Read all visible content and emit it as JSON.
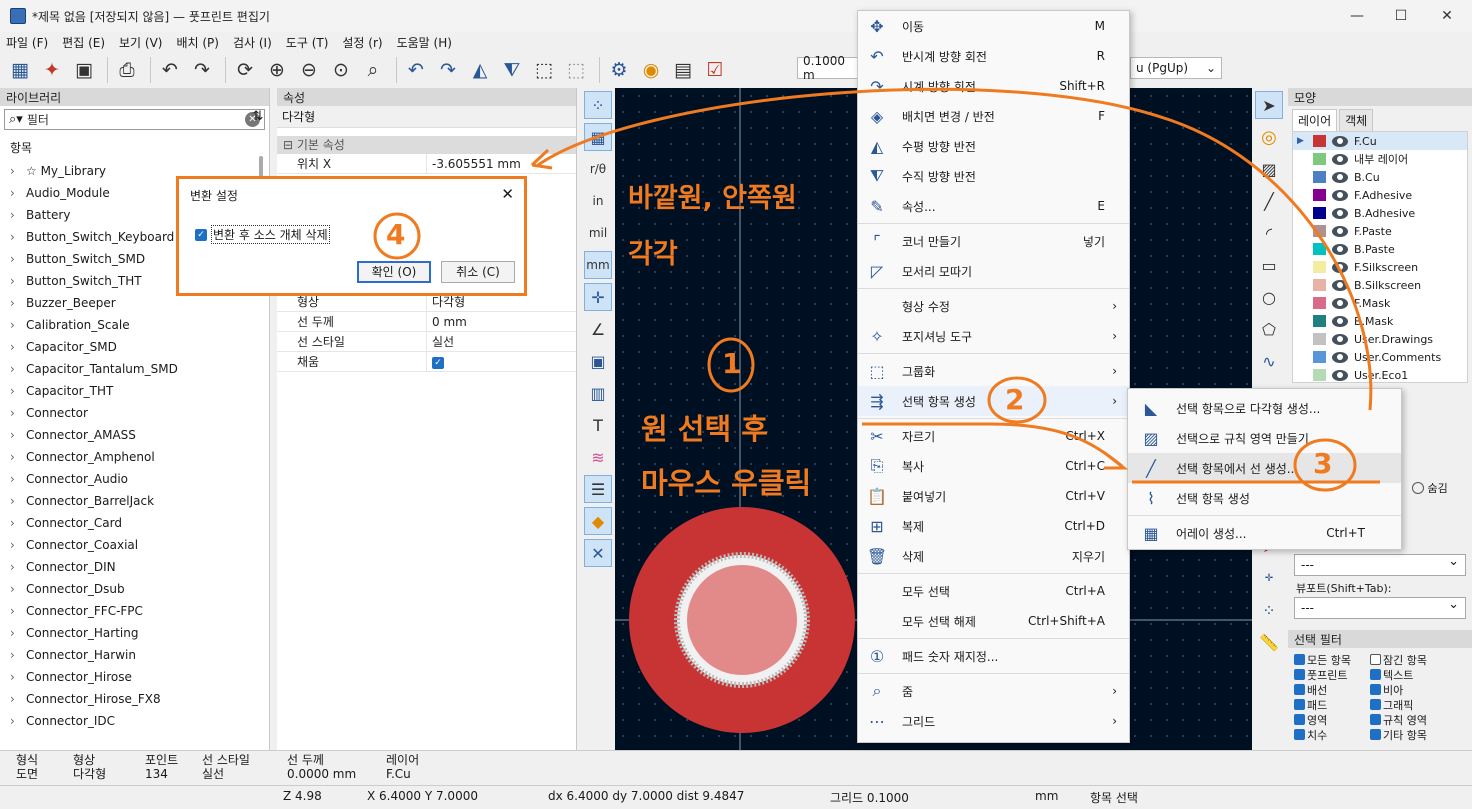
{
  "window": {
    "title": "*제목 없음 [저장되지 않음] — 풋프린트 편집기",
    "minimize": "—",
    "maximize": "☐",
    "close": "✕"
  },
  "menu": [
    "파일 (F)",
    "편집 (E)",
    "보기 (V)",
    "배치 (P)",
    "검사 (I)",
    "도구 (T)",
    "설정 (r)",
    "도움말 (H)"
  ],
  "toolbar": {
    "grid_combo": "0.1000 m",
    "layer_combo": "u (PgUp)"
  },
  "library": {
    "header": "라이브러리",
    "search_placeholder": "필터",
    "column": "항목",
    "items": [
      "☆ My_Library",
      "Audio_Module",
      "Battery",
      "Button_Switch_Keyboard",
      "Button_Switch_SMD",
      "Button_Switch_THT",
      "Buzzer_Beeper",
      "Calibration_Scale",
      "Capacitor_SMD",
      "Capacitor_Tantalum_SMD",
      "Capacitor_THT",
      "Connector",
      "Connector_AMASS",
      "Connector_Amphenol",
      "Connector_Audio",
      "Connector_BarrelJack",
      "Connector_Card",
      "Connector_Coaxial",
      "Connector_DIN",
      "Connector_Dsub",
      "Connector_FFC-FPC",
      "Connector_Harting",
      "Connector_Harwin",
      "Connector_Hirose",
      "Connector_Hirose_FX8",
      "Connector_IDC"
    ]
  },
  "properties": {
    "header": "속성",
    "type": "다각형",
    "section_basic": "기본 속성",
    "pos_x_label": "위치 X",
    "pos_x_value": "-3.605551 mm",
    "rows": [
      {
        "k": "형상",
        "v": "다각형"
      },
      {
        "k": "선 두께",
        "v": "0 mm"
      },
      {
        "k": "선 스타일",
        "v": "실선"
      },
      {
        "k": "채움",
        "v": ""
      }
    ]
  },
  "ltools": [
    "r/θ",
    "in",
    "mil",
    "mm"
  ],
  "dialog": {
    "title": "변환 설정",
    "checkbox": "변환 후 소스 개체 삭제",
    "ok": "확인 (O)",
    "cancel": "취소 (C)",
    "close": "✕"
  },
  "context_menu": [
    {
      "icon": "✥",
      "label": "이동",
      "shortcut": "M"
    },
    {
      "icon": "↶",
      "label": "반시계 방향 회전",
      "shortcut": "R"
    },
    {
      "icon": "↷",
      "label": "시계 방향 회전",
      "shortcut": "Shift+R"
    },
    {
      "icon": "◈",
      "label": "배치면 변경 / 반전",
      "shortcut": "F"
    },
    {
      "icon": "◭",
      "label": "수평 방향 반전",
      "shortcut": ""
    },
    {
      "icon": "⧨",
      "label": "수직 방향 반전",
      "shortcut": ""
    },
    {
      "icon": "✎",
      "label": "속성...",
      "shortcut": "E"
    },
    {
      "icon": "⌜",
      "label": "코너 만들기",
      "shortcut": "넣기"
    },
    {
      "icon": "◸",
      "label": "모서리 모따기",
      "shortcut": ""
    },
    {
      "icon": "",
      "label": "형상 수정",
      "shortcut": "",
      "sub": "›"
    },
    {
      "icon": "✧",
      "label": "포지셔닝 도구",
      "shortcut": "",
      "sub": "›"
    },
    {
      "icon": "⬚",
      "label": "그룹화",
      "shortcut": "",
      "sub": "›"
    },
    {
      "icon": "⇶",
      "label": "선택 항목 생성",
      "shortcut": "",
      "sub": "›"
    },
    {
      "icon": "✂",
      "label": "자르기",
      "shortcut": "Ctrl+X"
    },
    {
      "icon": "⎘",
      "label": "복사",
      "shortcut": "Ctrl+C"
    },
    {
      "icon": "📋",
      "label": "붙여넣기",
      "shortcut": "Ctrl+V"
    },
    {
      "icon": "⊞",
      "label": "복제",
      "shortcut": "Ctrl+D"
    },
    {
      "icon": "🗑",
      "label": "삭제",
      "shortcut": "지우기"
    },
    {
      "icon": "",
      "label": "모두 선택",
      "shortcut": "Ctrl+A"
    },
    {
      "icon": "",
      "label": "모두 선택 해제",
      "shortcut": "Ctrl+Shift+A"
    },
    {
      "icon": "①",
      "label": "패드 숫자 재지정...",
      "shortcut": ""
    },
    {
      "icon": "⌕",
      "label": "줌",
      "shortcut": "",
      "sub": "›"
    },
    {
      "icon": "⋯",
      "label": "그리드",
      "shortcut": "",
      "sub": "›"
    }
  ],
  "submenu": [
    {
      "icon": "◣",
      "label": "선택 항목으로 다각형 생성...",
      "shortcut": ""
    },
    {
      "icon": "▨",
      "label": "선택으로 규칙 영역 만들기",
      "shortcut": ""
    },
    {
      "icon": "╱",
      "label": "선택 항목에서 선 생성...",
      "shortcut": ""
    },
    {
      "icon": "⌇",
      "label": "선택 항목 생성",
      "shortcut": ""
    },
    {
      "icon": "▦",
      "label": "어레이 생성...",
      "shortcut": "Ctrl+T"
    }
  ],
  "appearance": {
    "header": "모양",
    "tab_layers": "레이어",
    "tab_objects": "객체",
    "layers": [
      {
        "name": "F.Cu",
        "color": "#c83434"
      },
      {
        "name": "내부 레이어",
        "color": "#7fc97f"
      },
      {
        "name": "B.Cu",
        "color": "#4d7fc4"
      },
      {
        "name": "F.Adhesive",
        "color": "#84008f"
      },
      {
        "name": "B.Adhesive",
        "color": "#00008f"
      },
      {
        "name": "F.Paste",
        "color": "#b09090"
      },
      {
        "name": "B.Paste",
        "color": "#00c2c2"
      },
      {
        "name": "F.Silkscreen",
        "color": "#f2eda1"
      },
      {
        "name": "B.Silkscreen",
        "color": "#e8b2a7"
      },
      {
        "name": "F.Mask",
        "color": "#d86b8a"
      },
      {
        "name": "B.Mask",
        "color": "#1f8080"
      },
      {
        "name": "User.Drawings",
        "color": "#c2c2c2"
      },
      {
        "name": "User.Comments",
        "color": "#5996d6"
      },
      {
        "name": "User.Eco1",
        "color": "#b5dbb5"
      }
    ],
    "radio_hide": "숨김",
    "preset_value": "---",
    "viewport_label": "뷰포트(Shift+Tab):",
    "viewport_value": "---",
    "filter_header": "선택 필터",
    "filters": [
      {
        "label": "모든 항목",
        "checked": true
      },
      {
        "label": "잠긴 항목",
        "checked": false
      },
      {
        "label": "풋프린트",
        "checked": true
      },
      {
        "label": "텍스트",
        "checked": true
      },
      {
        "label": "배선",
        "checked": true
      },
      {
        "label": "비아",
        "checked": true
      },
      {
        "label": "패드",
        "checked": true
      },
      {
        "label": "그래픽",
        "checked": true
      },
      {
        "label": "영역",
        "checked": true
      },
      {
        "label": "규칙 영역",
        "checked": true
      },
      {
        "label": "치수",
        "checked": true
      },
      {
        "label": "기타 항목",
        "checked": true
      }
    ]
  },
  "status": {
    "cols": [
      {
        "k": "형식",
        "v": "도면"
      },
      {
        "k": "형상",
        "v": "다각형"
      },
      {
        "k": "포인트",
        "v": "134"
      },
      {
        "k": "선 스타일",
        "v": "실선"
      },
      {
        "k": "선 두께",
        "v": "0.0000 mm"
      },
      {
        "k": "레이어",
        "v": "F.Cu"
      }
    ],
    "zoom": "Z 4.98",
    "xy": "X 6.4000  Y 7.0000",
    "dist": "dx 6.4000  dy 7.0000  dist 9.4847",
    "grid": "그리드 0.1000",
    "units": "mm",
    "mode": "항목 선택"
  },
  "annotations": {
    "outer_inner": "바깥원, 안쪽원",
    "each": "각각",
    "select_circle": "원 선택 후",
    "right_click": "마우스 우클릭",
    "n1": "1",
    "n2": "2",
    "n3": "3",
    "n4": "4"
  }
}
